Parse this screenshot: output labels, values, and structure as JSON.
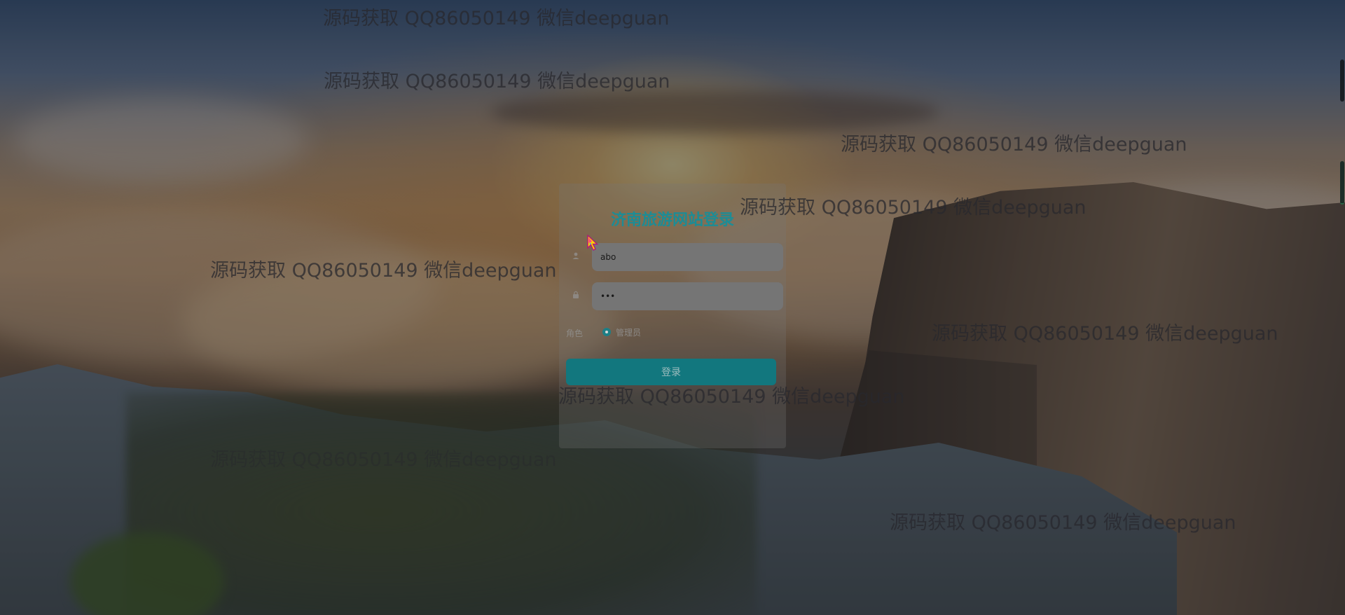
{
  "login": {
    "title": "济南旅游网站登录",
    "username_value": "abo",
    "password_value": "•••",
    "role_label": "角色",
    "role_option": "管理员",
    "submit_label": "登录"
  },
  "icons": {
    "user": "user-icon",
    "lock": "lock-icon"
  },
  "watermarks": [
    "源码获取 QQ86050149 微信deepguan",
    "源码获取 QQ86050149 微信deepguan",
    "源码获取 QQ86050149 微信deepguan",
    "源码获取 QQ86050149 微信deepguan",
    "源码获取 QQ86050149 微信deepguan",
    "源码获取 QQ86050149 微信deepguan",
    "源码获取 QQ86050149 微信deepguan",
    "源码获取 QQ86050149 微信deepguan",
    "源码获取 QQ86050149 微信deepguan"
  ],
  "colors": {
    "accent": "#1d8c95",
    "button": "#12777e"
  }
}
